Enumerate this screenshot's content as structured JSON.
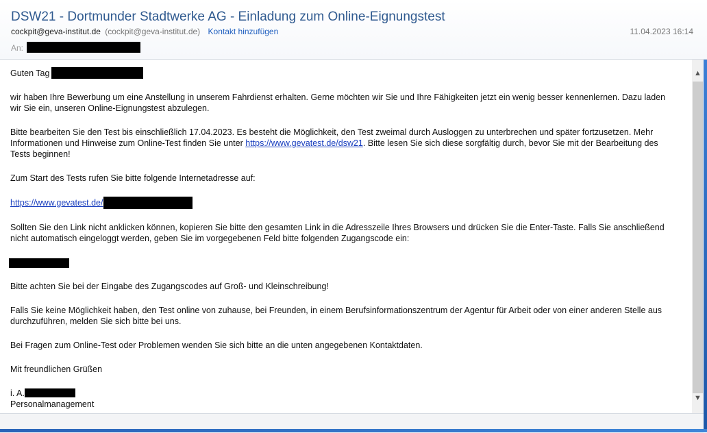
{
  "header": {
    "subject": "DSW21 - Dortmunder Stadtwerke AG - Einladung zum Online-Eignungstest",
    "from_email": "cockpit@geva-institut.de",
    "from_detail": "(cockpit@geva-institut.de)",
    "add_contact": "Kontakt hinzufügen",
    "date": "11.04.2023 16:14",
    "to_label": "An:"
  },
  "body": {
    "greeting": "Guten Tag",
    "p1": "wir haben Ihre Bewerbung um eine Anstellung in unserem Fahrdienst erhalten. Gerne möchten wir Sie und Ihre Fähigkeiten jetzt ein wenig besser kennenlernen. Dazu laden wir Sie ein, unseren Online-Eignungstest abzulegen.",
    "p2_before": "Bitte bearbeiten Sie den Test bis einschließlich 17.04.2023. Es besteht die Möglichkeit, den Test zweimal durch Ausloggen zu unterbrechen und später fortzusetzen. Mehr Informationen und Hinweise zum Online-Test finden Sie unter ",
    "p2_link": "https://www.gevatest.de/dsw21",
    "p2_after": ". Bitte lesen Sie sich diese sorgfältig durch, bevor Sie mit der Bearbeitung des Tests beginnen!",
    "p3": "Zum Start des Tests rufen Sie bitte folgende Internetadresse auf:",
    "start_link": "https://www.gevatest.de/",
    "p4": "Sollten Sie den Link nicht anklicken können, kopieren Sie bitte den gesamten Link in die Adresszeile Ihres Browsers und drücken Sie die Enter-Taste. Falls Sie anschließend nicht automatisch eingeloggt werden, geben Sie im vorgegebenen Feld bitte folgenden Zugangscode ein:",
    "p5": "Bitte achten Sie bei der Eingabe des Zugangscodes auf Groß- und Kleinschreibung!",
    "p6": "Falls Sie keine Möglichkeit haben, den Test online von zuhause, bei Freunden, in einem Berufsinformationszentrum der Agentur für Arbeit oder von einer anderen Stelle aus durchzuführen, melden Sie sich bitte bei uns.",
    "p7": "Bei Fragen zum Online-Test oder Problemen wenden Sie sich bitte an die unten angegebenen Kontaktdaten.",
    "closing": "Mit freundlichen Grüßen",
    "sig_prefix": "i. A.",
    "sig_dept": "Personalmanagement"
  },
  "icons": {
    "scroll_up": "▲",
    "scroll_down": "▼"
  },
  "colors": {
    "subject": "#2f5a8f",
    "link": "#1a3fbf",
    "accent": "#3c7fd6"
  }
}
